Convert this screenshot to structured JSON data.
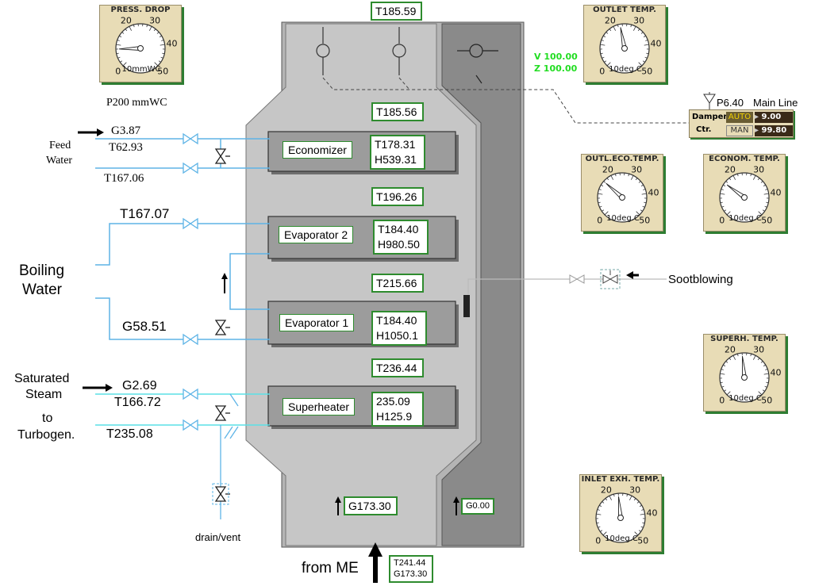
{
  "gauges": {
    "press_drop": {
      "title": "PRESS. DROP",
      "t0": "0",
      "t10": "10",
      "t20": "20",
      "t30": "30",
      "t40": "40",
      "t50": "50",
      "unit": "mmWC",
      "reading": 8
    },
    "outlet": {
      "title": "OUTLET TEMP.",
      "t0": "0",
      "t10": "10",
      "t20": "20",
      "t30": "30",
      "t40": "40",
      "t50": "50",
      "unit": "deg.C",
      "reading": 23
    },
    "outl_eco": {
      "title": "OUTL.ECO.TEMP.",
      "t0": "0",
      "t10": "10",
      "t20": "20",
      "t30": "30",
      "t40": "40",
      "t50": "50",
      "unit": "deg.C",
      "reading": 16
    },
    "econom": {
      "title": "ECONOM. TEMP.",
      "t0": "0",
      "t10": "10",
      "t20": "20",
      "t30": "30",
      "t40": "40",
      "t50": "50",
      "unit": "deg.C",
      "reading": 15
    },
    "superh": {
      "title": "SUPERH. TEMP.",
      "t0": "0",
      "t10": "10",
      "t20": "20",
      "t30": "30",
      "t40": "40",
      "t50": "50",
      "unit": "deg.C",
      "reading": 24
    },
    "inlet_exh": {
      "title": "INLET EXH. TEMP.",
      "t0": "0",
      "t10": "10",
      "t20": "20",
      "t30": "30",
      "t40": "40",
      "t50": "50",
      "unit": "deg.C",
      "reading": 24
    }
  },
  "press_value": "P200 mmWC",
  "top_temp": "T185.59",
  "vz": {
    "v": "V 100.00",
    "z": "Z 100.00"
  },
  "mainline": {
    "pressure": "P6.40",
    "label": "Main Line"
  },
  "damper": {
    "label": "Damper",
    "auto": "AUTO",
    "value": "9.00",
    "ctr_label": "Ctr.",
    "man": "MAN",
    "ctr_value": "99.80"
  },
  "boiler": {
    "t_upper": "T185.56",
    "t_mid1": "T196.26",
    "t_mid2": "T215.66",
    "t_lower": "T236.44",
    "gas_flow": "G173.30",
    "bypass_flow": "G0.00",
    "inlet_temp": "T241.44",
    "inlet_flow": "G173.30",
    "inlet_label": "from ME"
  },
  "exchangers": {
    "economizer": {
      "label": "Economizer",
      "t": "T178.31",
      "h": "H539.31"
    },
    "evaporator2": {
      "label": "Evaporator 2",
      "t": "T184.40",
      "h": "H980.50"
    },
    "evaporator1": {
      "label": "Evaporator 1",
      "t": "T184.40",
      "h": "H1050.1"
    },
    "superheater": {
      "label": "Superheater",
      "t": "235.09",
      "h": "H125.9"
    }
  },
  "feed": {
    "flow": "G3.87",
    "temp_in": "T62.93",
    "label1": "Feed",
    "label2": "Water",
    "temp_out": "T167.06"
  },
  "boiling": {
    "temp": "T167.07",
    "label1": "Boiling",
    "label2": "Water",
    "flow": "G58.51"
  },
  "steam": {
    "label1": "Saturated",
    "label2": "Steam",
    "label3": "to",
    "label4": "Turbogen.",
    "flow": "G2.69",
    "temp_sat": "T166.72",
    "temp_sh": "T235.08"
  },
  "drain_label": "drain/vent",
  "sootblowing_label": "Sootblowing"
}
